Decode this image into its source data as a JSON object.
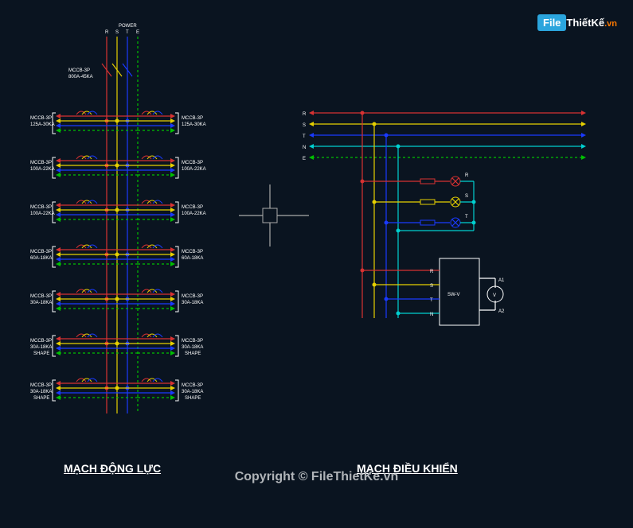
{
  "watermark": {
    "box": "File",
    "bold": "ThiếtKế",
    "suffix": ".vn"
  },
  "copyright": "Copyright © FileThietKe.vn",
  "titles": {
    "left": "MẠCH ĐỘNG LỰC",
    "right": "MẠCH ĐIỀU KHIỂN"
  },
  "power": {
    "label": "POWER",
    "phases": [
      "R",
      "S",
      "T",
      "E"
    ]
  },
  "main_breaker": {
    "line1": "MCCB-3P",
    "line2": "800A-45KA"
  },
  "branch_pairs": [
    {
      "left": {
        "line1": "MCCB-3P",
        "line2": "125A-30KA"
      },
      "right": {
        "line1": "MCCB-3P",
        "line2": "125A-30KA"
      }
    },
    {
      "left": {
        "line1": "MCCB-3P",
        "line2": "100A-22KA"
      },
      "right": {
        "line1": "MCCB-3P",
        "line2": "100A-22KA"
      }
    },
    {
      "left": {
        "line1": "MCCB-3P",
        "line2": "100A-22KA"
      },
      "right": {
        "line1": "MCCB-3P",
        "line2": "100A-22KA"
      }
    },
    {
      "left": {
        "line1": "MCCB-3P",
        "line2": "60A-18KA"
      },
      "right": {
        "line1": "MCCB-3P",
        "line2": "60A-18KA"
      }
    },
    {
      "left": {
        "line1": "MCCB-3P",
        "line2": "30A-18KA"
      },
      "right": {
        "line1": "MCCB-3P",
        "line2": "30A-18KA"
      }
    },
    {
      "left": {
        "line1": "MCCB-3P",
        "line2": "30A-18KA",
        "line3": "SHAPE"
      },
      "right": {
        "line1": "MCCB-3P",
        "line2": "30A-18KA",
        "line3": "SHAPE"
      }
    },
    {
      "left": {
        "line1": "MCCB-3P",
        "line2": "30A-18KA",
        "line3": "SHAPE"
      },
      "right": {
        "line1": "MCCB-3P",
        "line2": "30A-18KA",
        "line3": "SHAPE"
      }
    }
  ],
  "control_bus": [
    "R",
    "S",
    "T",
    "N",
    "E"
  ],
  "lamps": [
    {
      "label": "R"
    },
    {
      "label": "S"
    },
    {
      "label": "T"
    }
  ],
  "voltmeter": {
    "tag": "SW-V",
    "lines": [
      "R",
      "S",
      "T",
      "N"
    ],
    "terminals": [
      "A1",
      "A2"
    ],
    "symbol": "V"
  },
  "colors": {
    "R": "#d83232",
    "S": "#e6d000",
    "T": "#1a3aff",
    "N": "#00d0d0",
    "E": "#00c000"
  }
}
